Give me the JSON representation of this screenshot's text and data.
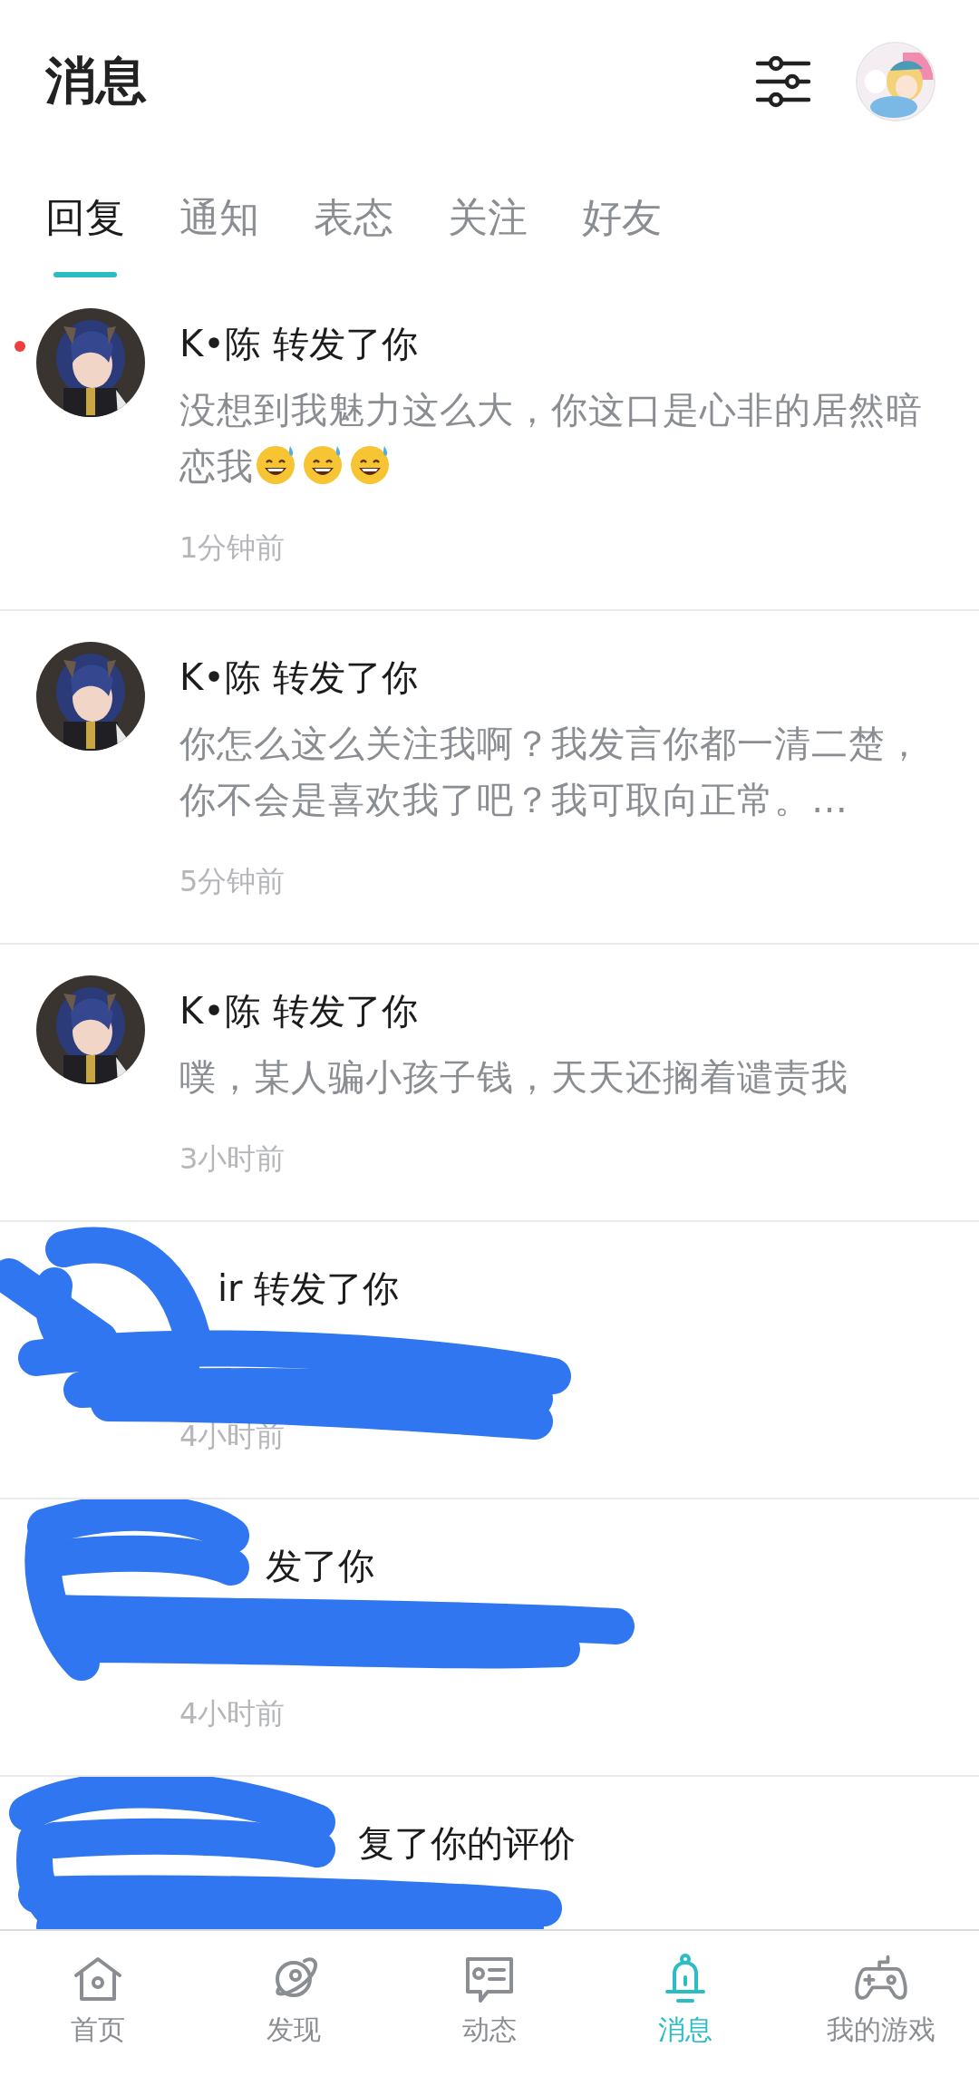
{
  "header": {
    "title": "消息"
  },
  "tabs": [
    {
      "label": "回复",
      "selected": true
    },
    {
      "label": "通知",
      "selected": false
    },
    {
      "label": "表态",
      "selected": false
    },
    {
      "label": "关注",
      "selected": false
    },
    {
      "label": "好友",
      "selected": false
    }
  ],
  "messages": [
    {
      "kind": "plain",
      "unread": true,
      "title": "K•陈 转发了你",
      "body": "没想到我魅力这么大，你这口是心非的居然暗恋我",
      "emoji": [
        {
          "kind": "grin-sweat"
        },
        {
          "kind": "grin-sweat"
        },
        {
          "kind": "grin-sweat"
        }
      ],
      "time": "1分钟前"
    },
    {
      "kind": "plain",
      "unread": false,
      "title": "K•陈 转发了你",
      "body": "你怎么这么关注我啊？我发言你都一清二楚，你不会是喜欢我了吧？我可取向正常。…",
      "time": "5分钟前"
    },
    {
      "kind": "plain",
      "unread": false,
      "title": "K•陈 转发了你",
      "body": "噗，某人骗小孩子钱，天天还搁着谴责我",
      "time": "3小时前"
    },
    {
      "kind": "redacted",
      "unread": false,
      "title": "ir 转发了你",
      "time": "4小时前"
    },
    {
      "kind": "redacted",
      "unread": false,
      "title": "发了你",
      "time": "4小时前"
    },
    {
      "kind": "redacted",
      "unread": false,
      "title": "复了你的评价"
    }
  ],
  "nav": [
    {
      "kind": "home",
      "label": "首页",
      "selected": false
    },
    {
      "kind": "discover",
      "label": "发现",
      "selected": false
    },
    {
      "kind": "feed",
      "label": "动态",
      "selected": false
    },
    {
      "kind": "messages",
      "label": "消息",
      "selected": true
    },
    {
      "kind": "games",
      "label": "我的游戏",
      "selected": false
    }
  ]
}
